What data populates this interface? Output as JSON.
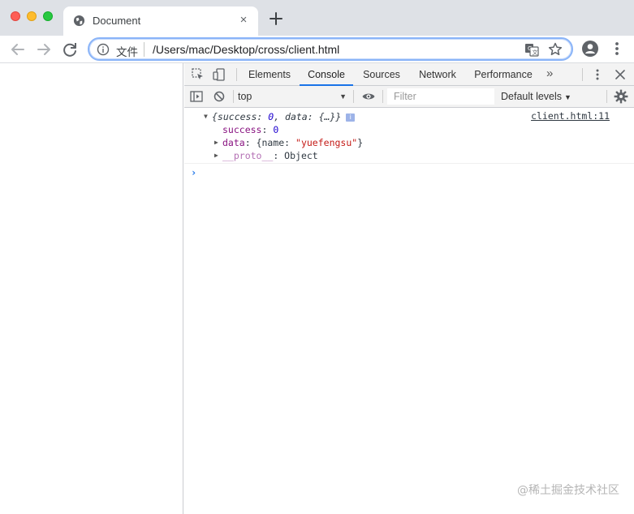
{
  "browser": {
    "tab": {
      "title": "Document",
      "close_label": "×"
    },
    "new_tab_label": "+",
    "omnibox": {
      "scheme_label": "文件",
      "url": "/Users/mac/Desktop/cross/client.html"
    }
  },
  "devtools": {
    "tabs": [
      {
        "label": "Elements",
        "active": false
      },
      {
        "label": "Console",
        "active": true
      },
      {
        "label": "Sources",
        "active": false
      },
      {
        "label": "Network",
        "active": false
      },
      {
        "label": "Performance",
        "active": false
      }
    ],
    "more_tabs_label": "»",
    "console_bar": {
      "context": "top",
      "filter_placeholder": "Filter",
      "levels": "Default levels"
    },
    "log": {
      "summary_prefix": "{success: ",
      "summary_success": "0",
      "summary_mid": ", data: ",
      "summary_data": "{…}",
      "summary_suffix": "}",
      "info_badge": "i",
      "source": "client.html:11",
      "success_key": "success",
      "success_value": "0",
      "data_key": "data",
      "data_preview_open": "{name: ",
      "data_name_value": "\"yuefengsu\"",
      "data_preview_close": "}",
      "proto_key": "__proto__",
      "proto_value": "Object",
      "sep": ": "
    },
    "prompt_symbol": "›"
  },
  "watermark": "@稀土掘金技术社区",
  "colors": {
    "tabstrip": "#dee1e6",
    "active_tab_underline": "#1a73e8",
    "key": "#881280",
    "number": "#1c00cf",
    "string": "#c41a16"
  }
}
